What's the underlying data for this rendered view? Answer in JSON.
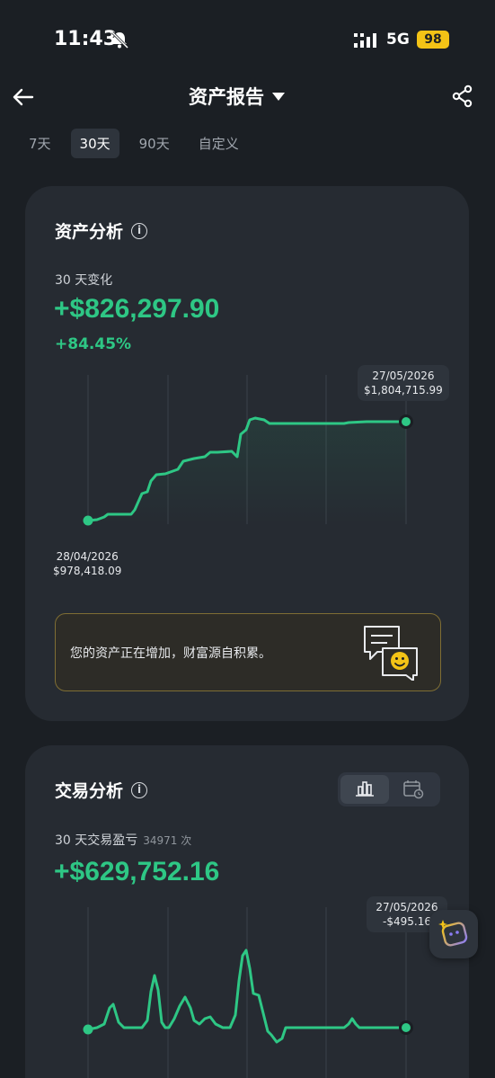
{
  "status": {
    "time": "11:43",
    "network": "5G",
    "battery": "98"
  },
  "nav": {
    "title": "资产报告"
  },
  "range_tabs": [
    "7天",
    "30天",
    "90天",
    "自定义"
  ],
  "asset": {
    "title": "资产分析",
    "info": "i",
    "change_label": "30 天变化",
    "change_value": "+$826,297.90",
    "change_pct": "+84.45%",
    "end_date": "27/05/2026",
    "end_value": "$1,804,715.99",
    "start_date": "28/04/2026",
    "start_value": "$978,418.09",
    "banner": "您的资产正在增加，财富源自积累。"
  },
  "trade": {
    "title": "交易分析",
    "info": "i",
    "pnl_label": "30 天交易盈亏",
    "count": "34971 次",
    "pnl_value": "+$629,752.16",
    "end_date": "27/05/2026",
    "end_value": "-$495.16"
  },
  "colors": {
    "accent": "#2ec785",
    "card": "#262b32",
    "background": "#1b1f24"
  }
}
